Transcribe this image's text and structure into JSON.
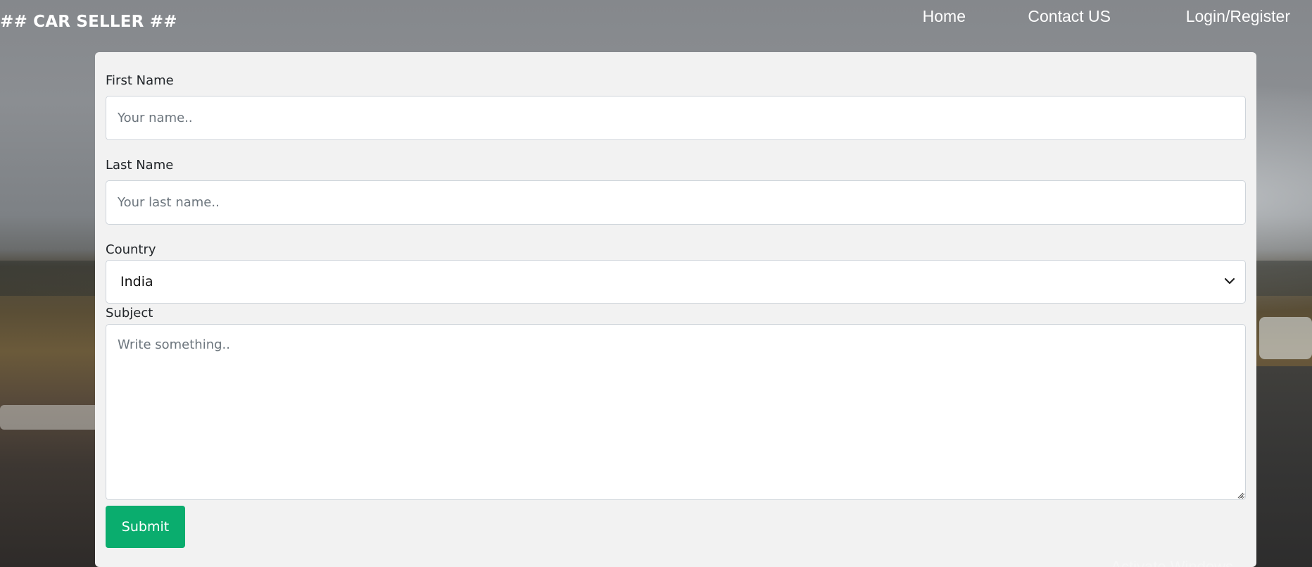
{
  "brand": "## CAR SELLER ##",
  "nav": {
    "items": [
      {
        "label": "Home"
      },
      {
        "label": "Contact US"
      },
      {
        "label": "Login/Register"
      }
    ]
  },
  "form": {
    "first_name": {
      "label": "First Name",
      "placeholder": "Your name..",
      "value": ""
    },
    "last_name": {
      "label": "Last Name",
      "placeholder": "Your last name..",
      "value": ""
    },
    "country": {
      "label": "Country",
      "selected": "India"
    },
    "subject": {
      "label": "Subject",
      "placeholder": "Write something..",
      "value": ""
    },
    "submit_label": "Submit"
  },
  "icons": {
    "select_arrow": "chevron-down-icon",
    "textarea_grip": "resize-grip-icon"
  },
  "colors": {
    "submit_bg": "#0aad6e",
    "card_bg": "#f2f2f2",
    "nav_text": "#ffffff"
  },
  "overlay": {
    "watermark": "Activate Windows"
  }
}
